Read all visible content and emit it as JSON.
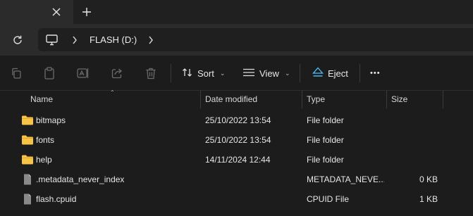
{
  "tab": {
    "close_icon": "close-icon",
    "new_tab_icon": "plus-icon"
  },
  "address": {
    "refresh_icon": "refresh-icon",
    "root_icon": "computer-icon",
    "crumb": "FLASH (D:)"
  },
  "toolbar": {
    "sort_label": "Sort",
    "view_label": "View",
    "eject_label": "Eject",
    "more_label": "•••"
  },
  "columns": {
    "name": "Name",
    "date": "Date modified",
    "type": "Type",
    "size": "Size"
  },
  "files": [
    {
      "name": "bitmaps",
      "date": "25/10/2022 13:54",
      "type": "File folder",
      "size": "",
      "icon": "folder-icon"
    },
    {
      "name": "fonts",
      "date": "25/10/2022 13:54",
      "type": "File folder",
      "size": "",
      "icon": "folder-icon"
    },
    {
      "name": "help",
      "date": "14/11/2024 12:44",
      "type": "File folder",
      "size": "",
      "icon": "folder-icon"
    },
    {
      "name": ".metadata_never_index",
      "date": "",
      "type": "METADATA_NEVE...",
      "size": "0 KB",
      "icon": "file-icon"
    },
    {
      "name": "flash.cpuid",
      "date": "",
      "type": "CPUID File",
      "size": "1 KB",
      "icon": "file-icon"
    }
  ],
  "colors": {
    "folder": "#f8c445",
    "accent": "#4cc2ff"
  }
}
